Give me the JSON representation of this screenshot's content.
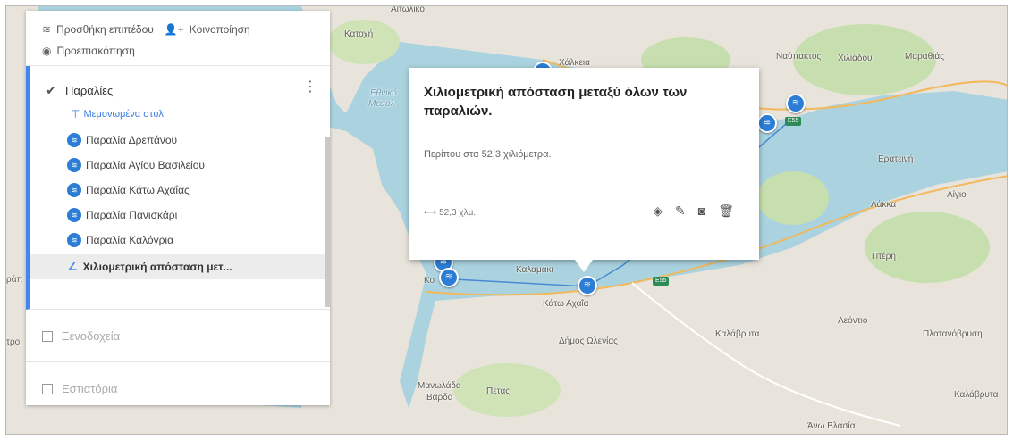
{
  "map": {
    "places": [
      {
        "id": "aitoliko",
        "label": "Αιτωλικό"
      },
      {
        "id": "katochi",
        "label": "Κατοχή"
      },
      {
        "id": "ethniko",
        "label": "Εθνικό"
      },
      {
        "id": "mesol",
        "label": "Μεσολ"
      },
      {
        "id": "chalkeia",
        "label": "Χάλκεια"
      },
      {
        "id": "nafpaktos",
        "label": "Ναύπακτος"
      },
      {
        "id": "xiliadou",
        "label": "Χιλιάδου"
      },
      {
        "id": "marathias",
        "label": "Μαραθιάς"
      },
      {
        "id": "eratini",
        "label": "Ερατεινή"
      },
      {
        "id": "aigio",
        "label": "Αίγιο"
      },
      {
        "id": "lakka",
        "label": "Λάκκα"
      },
      {
        "id": "pteri",
        "label": "Πτέρη"
      },
      {
        "id": "kalamaki",
        "label": "Καλαμάκι"
      },
      {
        "id": "kato_achaia",
        "label": "Κάτω Αχαΐα"
      },
      {
        "id": "dimos_olenias",
        "label": "Δήμος Ωλενίας"
      },
      {
        "id": "kalavryta",
        "label": "Καλάβρυτα"
      },
      {
        "id": "leontio",
        "label": "Λεόντιο"
      },
      {
        "id": "platanovrysi",
        "label": "Πλατανόβρυση"
      },
      {
        "id": "manolada",
        "label": "Μανωλάδα"
      },
      {
        "id": "varda",
        "label": "Βάρδα"
      },
      {
        "id": "petas",
        "label": "Πετας"
      },
      {
        "id": "kalavryta2",
        "label": "Καλάβρυτα"
      },
      {
        "id": "ano_vlasia",
        "label": "Άνω Βλασία"
      },
      {
        "id": "kopa",
        "label": "Κο"
      },
      {
        "id": "tro",
        "label": "τρο"
      },
      {
        "id": "pra",
        "label": "ράπ"
      }
    ],
    "road_badge": "E55",
    "marker_icon": "beach-icon",
    "route_color": "#4a8ad4"
  },
  "panel": {
    "add_layer": "Προσθήκη επιπέδου",
    "share": "Κοινοποίηση",
    "preview": "Προεπισκόπηση",
    "layers": [
      {
        "name": "Παραλίες",
        "checked": true,
        "style_label": "Μεμονωμένα στυλ",
        "items": [
          "Παραλία Δρεπάνου",
          "Παραλία Αγίου Βασιλείου",
          "Παραλία Κάτω Αχαΐας",
          "Παραλία Πανισκάρι",
          "Παραλία Καλόγρια"
        ],
        "selected_item": "Χιλιομετρική απόσταση μετ..."
      },
      {
        "name": "Ξενοδοχεία",
        "checked": false
      },
      {
        "name": "Εστιατόρια",
        "checked": false
      }
    ]
  },
  "info_window": {
    "title": "Χιλιομετρική απόσταση μεταξύ όλων των παραλιών.",
    "description": "Περίπου στα 52,3 χιλιόμετρα.",
    "measurement": "52,3 χλμ."
  },
  "colors": {
    "accent": "#4285f4",
    "marker": "#2b7dd5",
    "water": "#aad3df",
    "land": "#e8e4dc",
    "green": "#c7dfae"
  }
}
